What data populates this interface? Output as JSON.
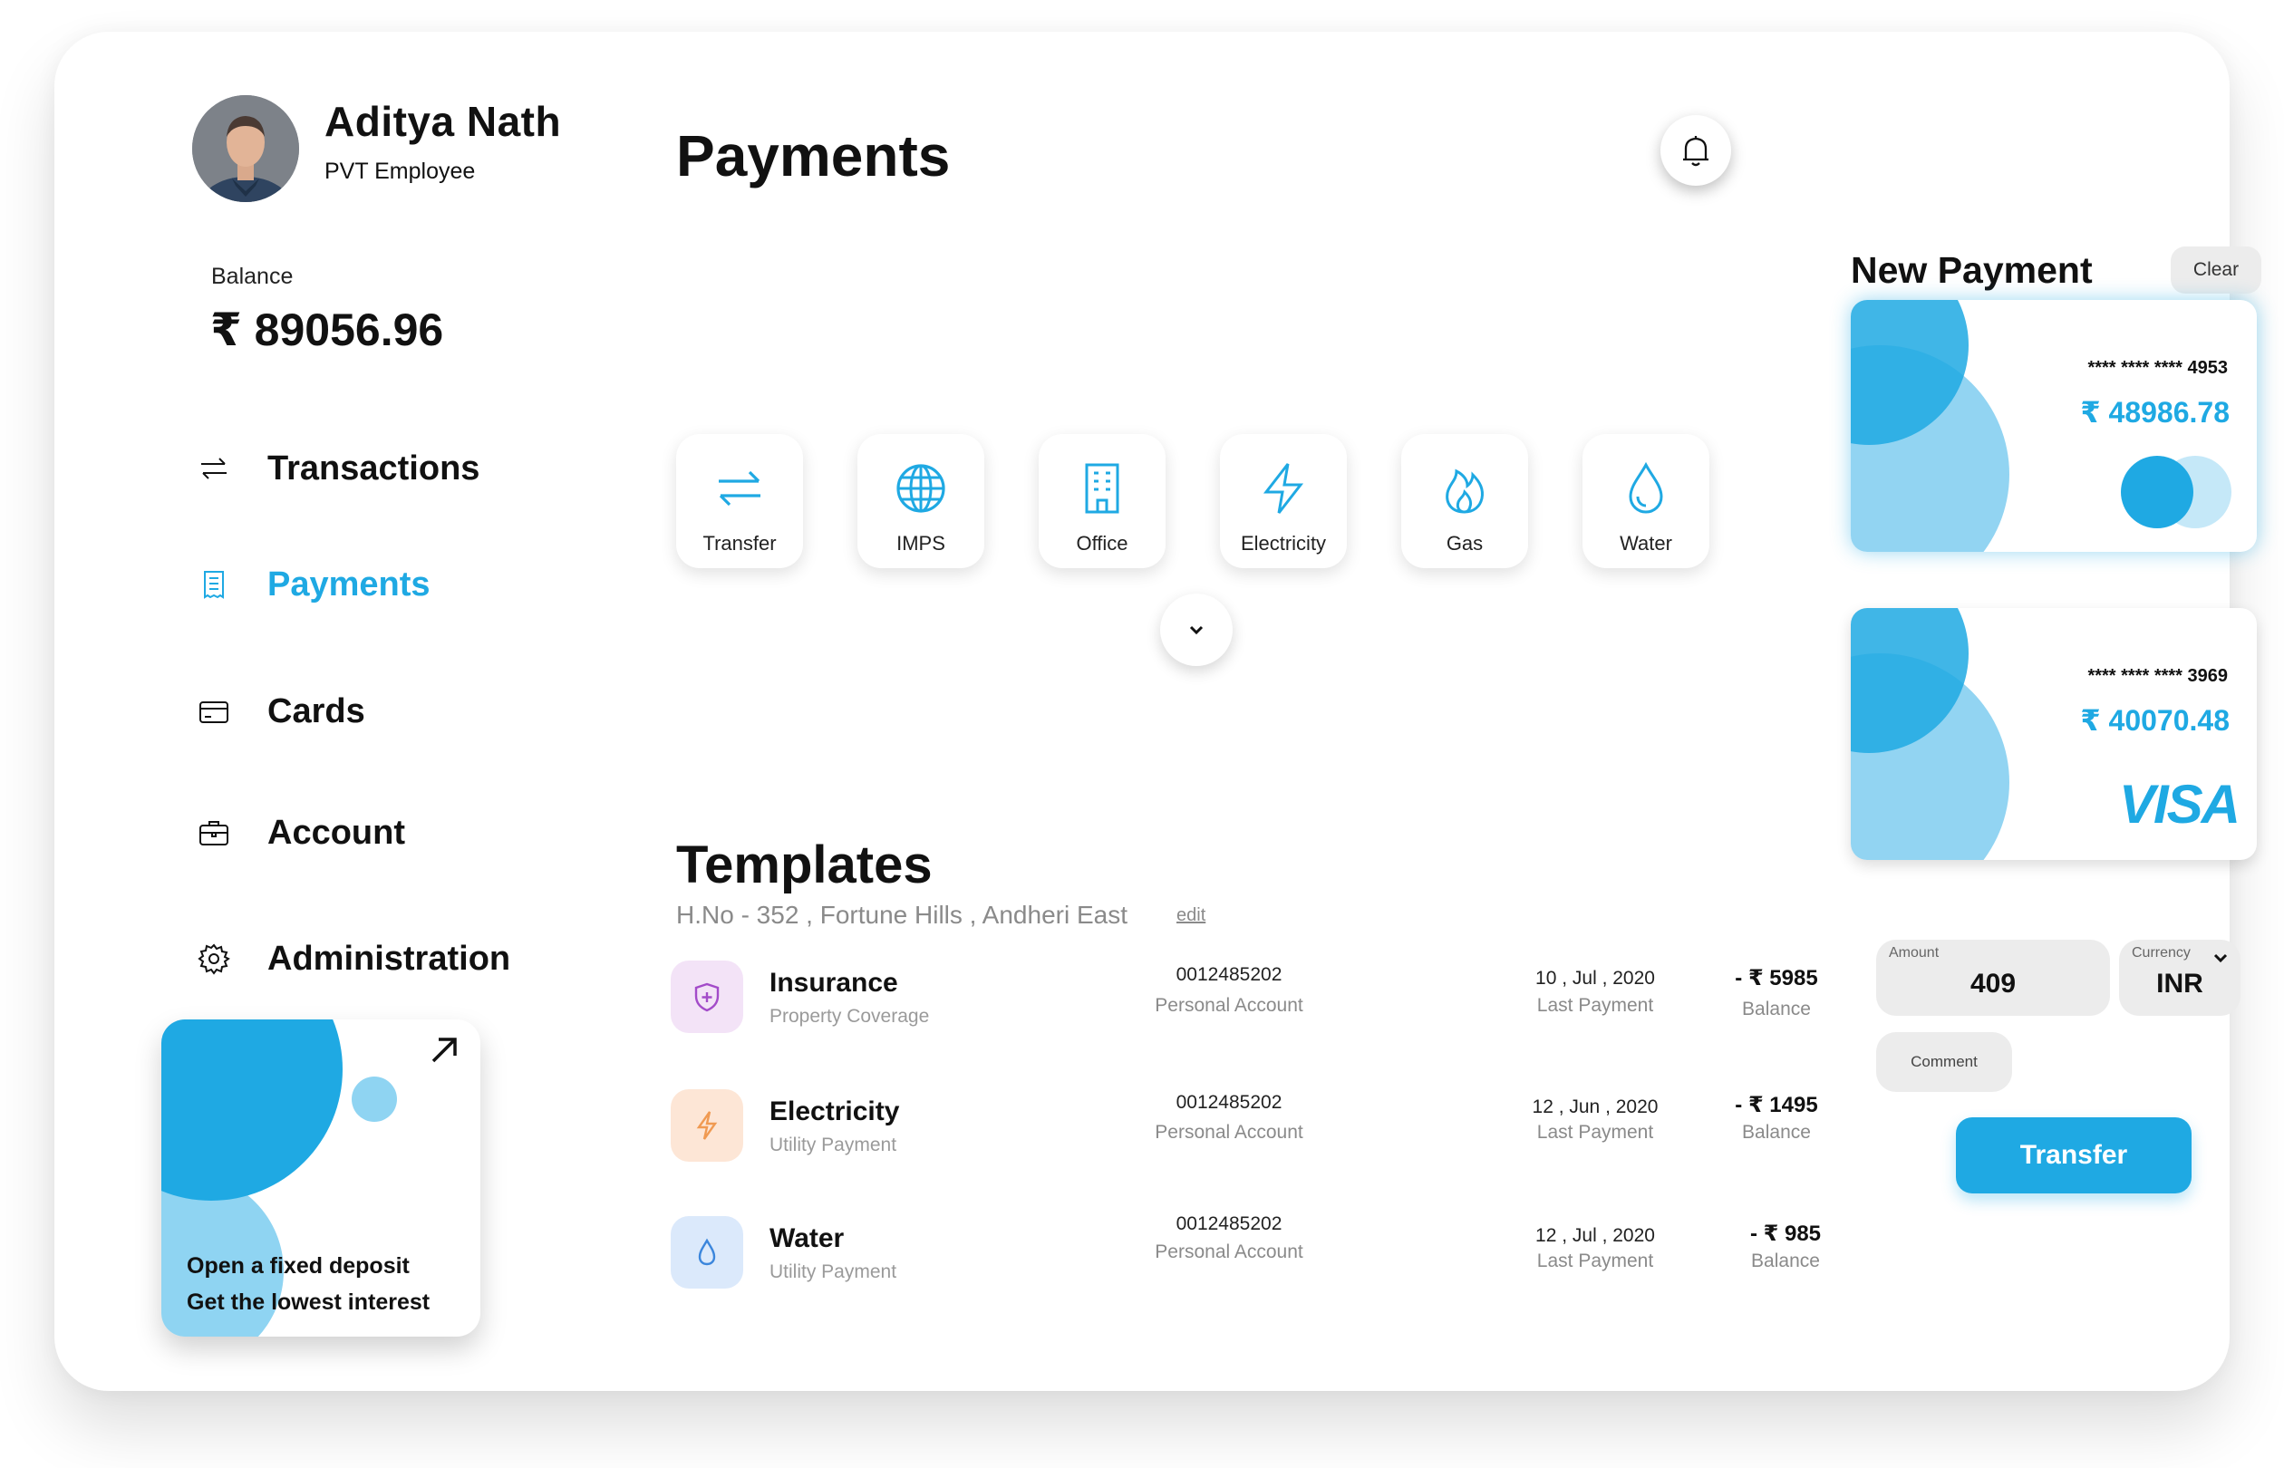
{
  "profile": {
    "name": "Aditya Nath",
    "role": "PVT Employee",
    "balance_label": "Balance",
    "balance_value": "₹ 89056.96"
  },
  "sidebar": {
    "items": [
      {
        "label": "Transactions",
        "icon": "swap-arrows-icon",
        "active": false
      },
      {
        "label": "Payments",
        "icon": "receipt-icon",
        "active": true
      },
      {
        "label": "Cards",
        "icon": "credit-card-icon",
        "active": false
      },
      {
        "label": "Account",
        "icon": "briefcase-icon",
        "active": false
      },
      {
        "label": "Administration",
        "icon": "gear-icon",
        "active": false
      }
    ]
  },
  "promo": {
    "line1": "Open a fixed deposit",
    "line2": "Get the lowest interest",
    "icon": "arrow-up-right-icon"
  },
  "main": {
    "title": "Payments",
    "notification_icon": "bell-icon",
    "categories": [
      {
        "label": "Transfer",
        "icon": "transfer-icon"
      },
      {
        "label": "IMPS",
        "icon": "globe-icon"
      },
      {
        "label": "Office",
        "icon": "building-icon"
      },
      {
        "label": "Electricity",
        "icon": "lightning-icon"
      },
      {
        "label": "Gas",
        "icon": "flame-icon"
      },
      {
        "label": "Water",
        "icon": "water-drop-icon"
      }
    ],
    "expand_icon": "chevron-down-icon"
  },
  "templates": {
    "title": "Templates",
    "address": "H.No - 352 , Fortune Hills , Andheri East",
    "edit_label": "edit",
    "rows": [
      {
        "name": "Insurance",
        "type": "Property Coverage",
        "account": "0012485202",
        "account_type": "Personal Account",
        "date": "10 , Jul , 2020",
        "date_label": "Last Payment",
        "amount": "- ₹ 5985",
        "amount_label": "Balance",
        "icon": "shield-icon"
      },
      {
        "name": "Electricity",
        "type": "Utility Payment",
        "account": "0012485202",
        "account_type": "Personal Account",
        "date": "12 , Jun , 2020",
        "date_label": "Last Payment",
        "amount": "- ₹ 1495",
        "amount_label": "Balance",
        "icon": "lightning-icon"
      },
      {
        "name": "Water",
        "type": "Utility Payment",
        "account": "0012485202",
        "account_type": "Personal Account",
        "date": "12 , Jul , 2020",
        "date_label": "Last Payment",
        "amount": "- ₹ 985",
        "amount_label": "Balance",
        "icon": "water-drop-icon"
      }
    ]
  },
  "new_payment": {
    "title": "New Payment",
    "clear_label": "Clear",
    "cards": [
      {
        "number": "**** **** **** 4953",
        "balance": "₹ 48986.78",
        "brand": "mastercard",
        "selected": true
      },
      {
        "number": "**** **** **** 3969",
        "balance": "₹ 40070.48",
        "brand": "VISA",
        "selected": false
      }
    ],
    "amount_label": "Amount",
    "amount_value": "409",
    "currency_label": "Currency",
    "currency_value": "INR",
    "comment_placeholder": "Comment",
    "transfer_label": "Transfer"
  },
  "colors": {
    "accent": "#1fa9e3",
    "accent_light": "#8fd4f2",
    "insurance_bg": "#f3e3f7",
    "insurance_icon": "#a34bc9",
    "electricity_bg": "#fde6d6",
    "electricity_icon": "#f09a52",
    "water_bg": "#dbe9fb",
    "water_icon": "#3b86dc"
  }
}
